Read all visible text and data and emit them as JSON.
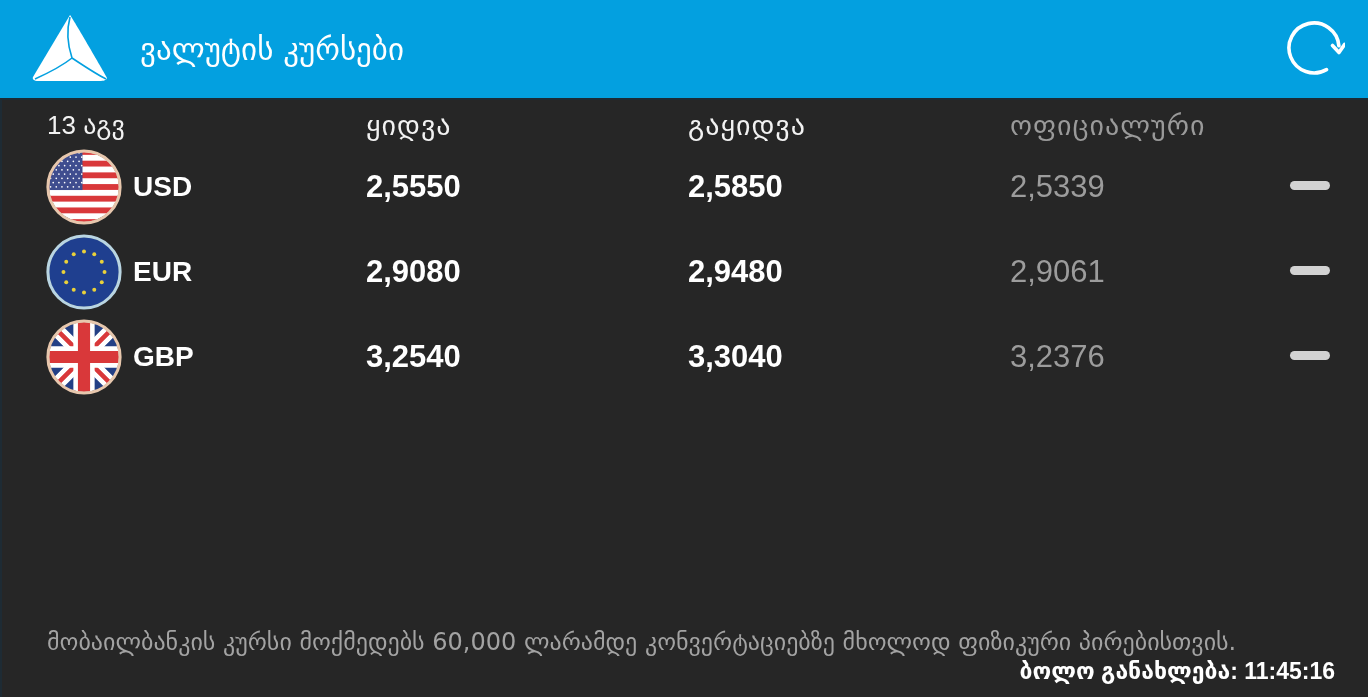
{
  "app_bar": {
    "title": "ვალუტის კურსები"
  },
  "table": {
    "columns": [
      "13 აგვ",
      "ყიდვა",
      "გაყიდვა",
      "ოფიციალური"
    ],
    "rows": [
      {
        "kind": "us",
        "currency": "USD",
        "buy": "2,5550",
        "sell": "2,5850",
        "official": "2,5339",
        "trend": {
          "kind": "flat"
        }
      },
      {
        "kind": "eu",
        "currency": "EUR",
        "buy": "2,9080",
        "sell": "2,9480",
        "official": "2,9061",
        "trend": {
          "kind": "flat"
        }
      },
      {
        "kind": "uk",
        "currency": "GBP",
        "buy": "3,2540",
        "sell": "3,3040",
        "official": "3,2376",
        "trend": {
          "kind": "flat"
        }
      }
    ]
  },
  "footer": {
    "note": "მობაილბანკის კურსი მოქმედებს 60,000 ლარამდე კონვერტაციებზე მხოლოდ ფიზიკური პირებისთვის.",
    "last_updated": "ბოლო განახლება: 11:45:16"
  }
}
